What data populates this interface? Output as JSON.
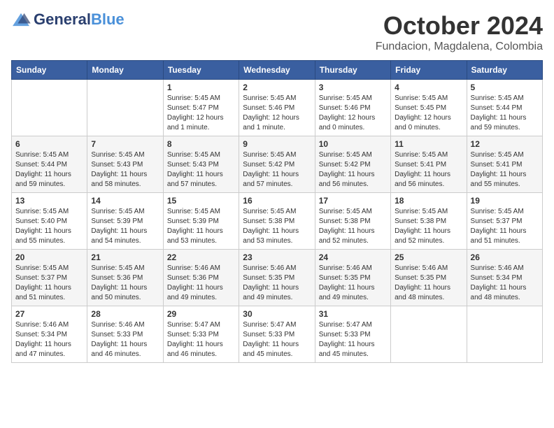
{
  "logo": {
    "name1": "General",
    "name2": "Blue",
    "tagline": "Blue"
  },
  "title": "October 2024",
  "subtitle": "Fundacion, Magdalena, Colombia",
  "weekdays": [
    "Sunday",
    "Monday",
    "Tuesday",
    "Wednesday",
    "Thursday",
    "Friday",
    "Saturday"
  ],
  "weeks": [
    [
      {
        "day": "",
        "info": ""
      },
      {
        "day": "",
        "info": ""
      },
      {
        "day": "1",
        "info": "Sunrise: 5:45 AM\nSunset: 5:47 PM\nDaylight: 12 hours\nand 1 minute."
      },
      {
        "day": "2",
        "info": "Sunrise: 5:45 AM\nSunset: 5:46 PM\nDaylight: 12 hours\nand 1 minute."
      },
      {
        "day": "3",
        "info": "Sunrise: 5:45 AM\nSunset: 5:46 PM\nDaylight: 12 hours\nand 0 minutes."
      },
      {
        "day": "4",
        "info": "Sunrise: 5:45 AM\nSunset: 5:45 PM\nDaylight: 12 hours\nand 0 minutes."
      },
      {
        "day": "5",
        "info": "Sunrise: 5:45 AM\nSunset: 5:44 PM\nDaylight: 11 hours\nand 59 minutes."
      }
    ],
    [
      {
        "day": "6",
        "info": "Sunrise: 5:45 AM\nSunset: 5:44 PM\nDaylight: 11 hours\nand 59 minutes."
      },
      {
        "day": "7",
        "info": "Sunrise: 5:45 AM\nSunset: 5:43 PM\nDaylight: 11 hours\nand 58 minutes."
      },
      {
        "day": "8",
        "info": "Sunrise: 5:45 AM\nSunset: 5:43 PM\nDaylight: 11 hours\nand 57 minutes."
      },
      {
        "day": "9",
        "info": "Sunrise: 5:45 AM\nSunset: 5:42 PM\nDaylight: 11 hours\nand 57 minutes."
      },
      {
        "day": "10",
        "info": "Sunrise: 5:45 AM\nSunset: 5:42 PM\nDaylight: 11 hours\nand 56 minutes."
      },
      {
        "day": "11",
        "info": "Sunrise: 5:45 AM\nSunset: 5:41 PM\nDaylight: 11 hours\nand 56 minutes."
      },
      {
        "day": "12",
        "info": "Sunrise: 5:45 AM\nSunset: 5:41 PM\nDaylight: 11 hours\nand 55 minutes."
      }
    ],
    [
      {
        "day": "13",
        "info": "Sunrise: 5:45 AM\nSunset: 5:40 PM\nDaylight: 11 hours\nand 55 minutes."
      },
      {
        "day": "14",
        "info": "Sunrise: 5:45 AM\nSunset: 5:39 PM\nDaylight: 11 hours\nand 54 minutes."
      },
      {
        "day": "15",
        "info": "Sunrise: 5:45 AM\nSunset: 5:39 PM\nDaylight: 11 hours\nand 53 minutes."
      },
      {
        "day": "16",
        "info": "Sunrise: 5:45 AM\nSunset: 5:38 PM\nDaylight: 11 hours\nand 53 minutes."
      },
      {
        "day": "17",
        "info": "Sunrise: 5:45 AM\nSunset: 5:38 PM\nDaylight: 11 hours\nand 52 minutes."
      },
      {
        "day": "18",
        "info": "Sunrise: 5:45 AM\nSunset: 5:38 PM\nDaylight: 11 hours\nand 52 minutes."
      },
      {
        "day": "19",
        "info": "Sunrise: 5:45 AM\nSunset: 5:37 PM\nDaylight: 11 hours\nand 51 minutes."
      }
    ],
    [
      {
        "day": "20",
        "info": "Sunrise: 5:45 AM\nSunset: 5:37 PM\nDaylight: 11 hours\nand 51 minutes."
      },
      {
        "day": "21",
        "info": "Sunrise: 5:45 AM\nSunset: 5:36 PM\nDaylight: 11 hours\nand 50 minutes."
      },
      {
        "day": "22",
        "info": "Sunrise: 5:46 AM\nSunset: 5:36 PM\nDaylight: 11 hours\nand 49 minutes."
      },
      {
        "day": "23",
        "info": "Sunrise: 5:46 AM\nSunset: 5:35 PM\nDaylight: 11 hours\nand 49 minutes."
      },
      {
        "day": "24",
        "info": "Sunrise: 5:46 AM\nSunset: 5:35 PM\nDaylight: 11 hours\nand 49 minutes."
      },
      {
        "day": "25",
        "info": "Sunrise: 5:46 AM\nSunset: 5:35 PM\nDaylight: 11 hours\nand 48 minutes."
      },
      {
        "day": "26",
        "info": "Sunrise: 5:46 AM\nSunset: 5:34 PM\nDaylight: 11 hours\nand 48 minutes."
      }
    ],
    [
      {
        "day": "27",
        "info": "Sunrise: 5:46 AM\nSunset: 5:34 PM\nDaylight: 11 hours\nand 47 minutes."
      },
      {
        "day": "28",
        "info": "Sunrise: 5:46 AM\nSunset: 5:33 PM\nDaylight: 11 hours\nand 46 minutes."
      },
      {
        "day": "29",
        "info": "Sunrise: 5:47 AM\nSunset: 5:33 PM\nDaylight: 11 hours\nand 46 minutes."
      },
      {
        "day": "30",
        "info": "Sunrise: 5:47 AM\nSunset: 5:33 PM\nDaylight: 11 hours\nand 45 minutes."
      },
      {
        "day": "31",
        "info": "Sunrise: 5:47 AM\nSunset: 5:33 PM\nDaylight: 11 hours\nand 45 minutes."
      },
      {
        "day": "",
        "info": ""
      },
      {
        "day": "",
        "info": ""
      }
    ]
  ]
}
